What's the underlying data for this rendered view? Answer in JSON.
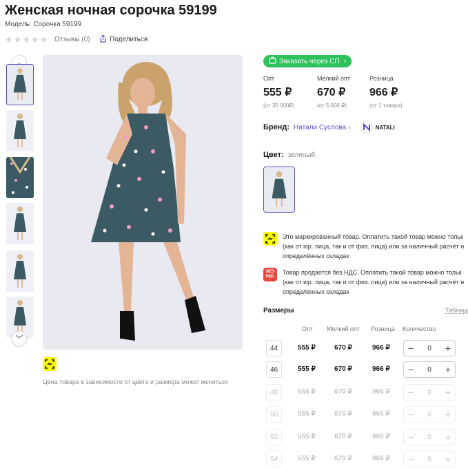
{
  "product": {
    "title": "Женская ночная сорочка 59199",
    "model": "Модель: Сорочка 59199",
    "reviews": "Отзывы (0)",
    "share": "Поделиться",
    "price_note": "Цена товара в зависимости от цвета и размера может меняться",
    "rating": 0,
    "rating_max": 5
  },
  "order_button": "Заказать через СП",
  "prices": [
    {
      "label": "Опт",
      "value": "555 ₽",
      "min": "(от 35 000₽)"
    },
    {
      "label": "Мелкий опт",
      "value": "670 ₽",
      "min": "(от 5 000 ₽)"
    },
    {
      "label": "Розница",
      "value": "966 ₽",
      "min": "(от 1 товара)"
    }
  ],
  "brand": {
    "label": "Бренд:",
    "link": "Натали Суслова",
    "logo_text": "NATALI"
  },
  "color": {
    "label": "Цвет:",
    "value": "зеленый"
  },
  "notices": [
    {
      "icon": "marking-icon",
      "text": "Это маркированный товар. Оплатить такой товар можно тольк (как от юр. лица, так и от физ. лица) или за наличный расчёт н определённых складах"
    },
    {
      "icon": "no-vat-icon",
      "icon_text": "БЕЗ НДС",
      "text": "Товар продается без НДС. Оплатить такой товар можно тольк (как от юр. лица, так и от физ. лица) или за наличный расчёт н определённых складах"
    }
  ],
  "sizes": {
    "header": "Размеры",
    "table_link": "Таблица",
    "columns": [
      "Опт",
      "Мелкий опт",
      "Розница",
      "Количество"
    ],
    "rows": [
      {
        "size": "44",
        "opt": "555 ₽",
        "small": "670 ₽",
        "retail": "966 ₽",
        "qty": "0",
        "available": true
      },
      {
        "size": "46",
        "opt": "555 ₽",
        "small": "670 ₽",
        "retail": "966 ₽",
        "qty": "0",
        "available": true
      },
      {
        "size": "48",
        "opt": "555 ₽",
        "small": "670 ₽",
        "retail": "966 ₽",
        "qty": "0",
        "available": false
      },
      {
        "size": "50",
        "opt": "555 ₽",
        "small": "670 ₽",
        "retail": "966 ₽",
        "qty": "0",
        "available": false
      },
      {
        "size": "52",
        "opt": "555 ₽",
        "small": "670 ₽",
        "retail": "966 ₽",
        "qty": "0",
        "available": false
      },
      {
        "size": "54",
        "opt": "555 ₽",
        "small": "670 ₽",
        "retail": "966 ₽",
        "qty": "0",
        "available": false
      }
    ]
  },
  "colors": {
    "accent": "#5b4cc9",
    "green": "#2fc15b",
    "marking": "#f6ff00",
    "novat": "#e8453c",
    "dress": "#3b5a63"
  }
}
